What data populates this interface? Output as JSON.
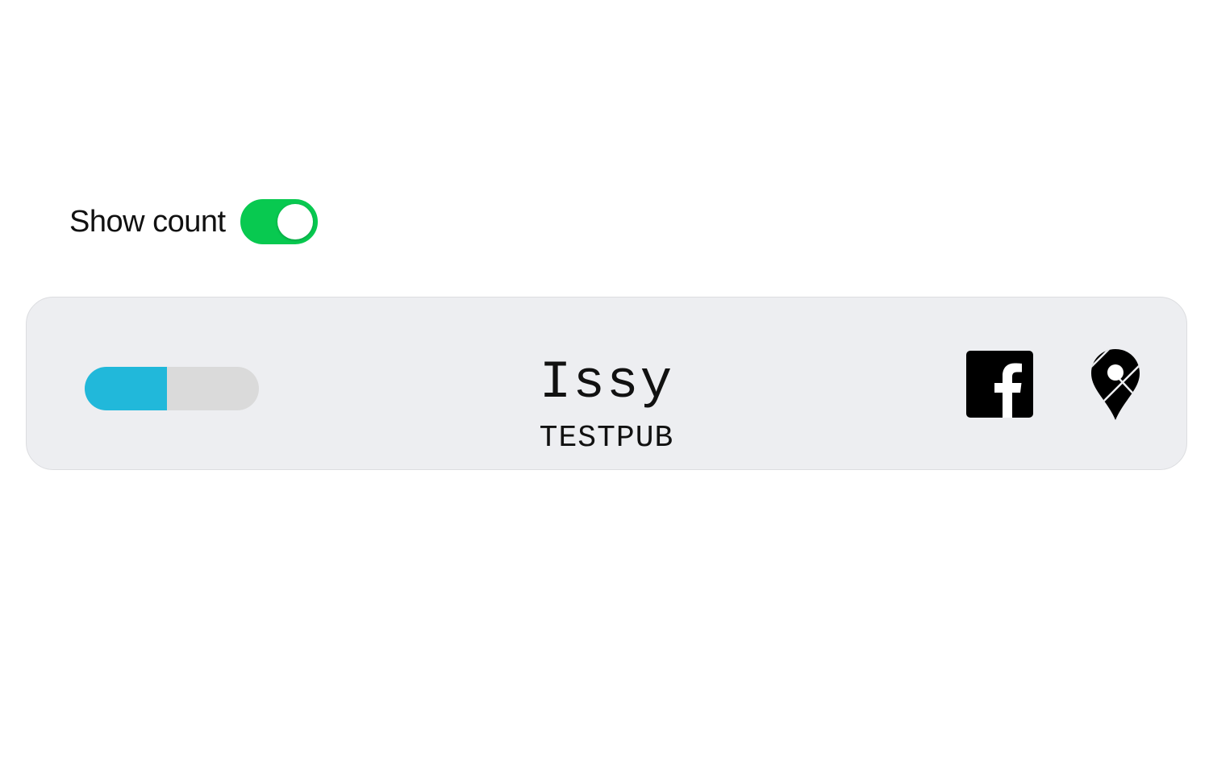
{
  "toggle": {
    "label": "Show count",
    "checked": true,
    "on_color": "#08c950"
  },
  "card": {
    "name": "Issy",
    "publication": "TESTPUB",
    "background": "#edeef1",
    "progress": {
      "fraction": 0.47,
      "fill_color": "#21b8da",
      "track_color": "#dadada"
    },
    "icons": [
      "facebook-icon",
      "map-pin-icon"
    ]
  }
}
